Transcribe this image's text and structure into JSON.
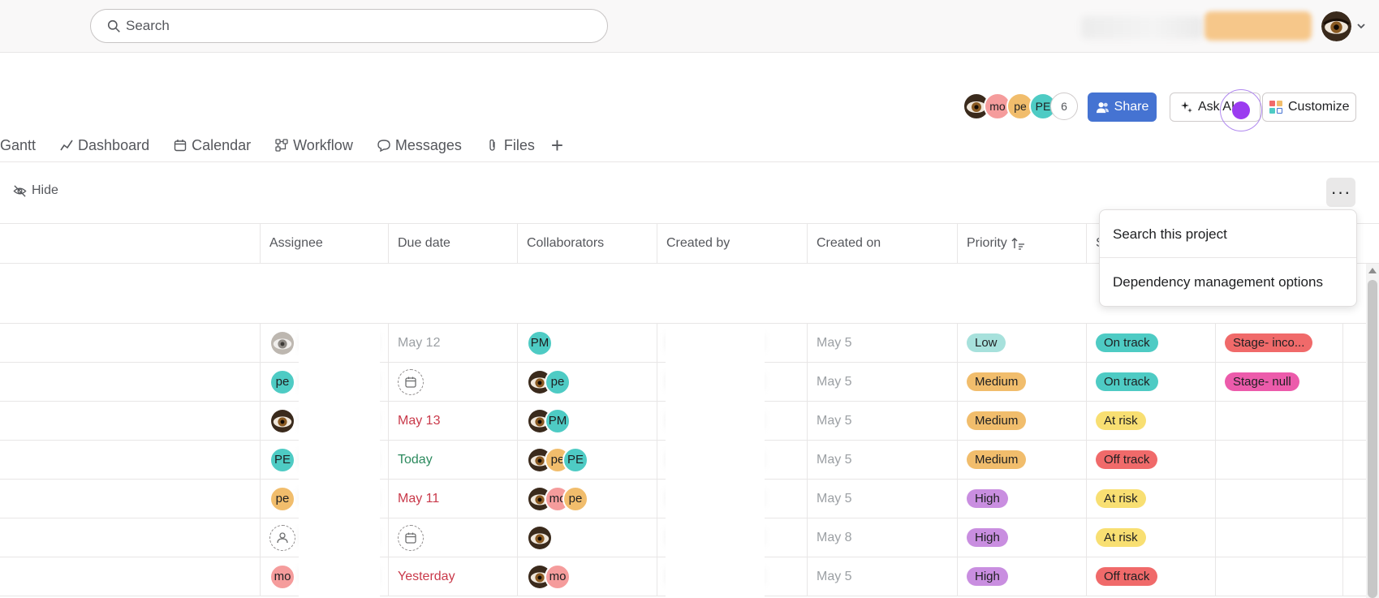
{
  "topbar": {
    "search_placeholder": "Search"
  },
  "header": {
    "members": [
      {
        "initials": "",
        "color": "#5b3b1e",
        "photo": true
      },
      {
        "initials": "mo",
        "color": "#f59c9c"
      },
      {
        "initials": "pe",
        "color": "#f1bd6c"
      },
      {
        "initials": "PE",
        "color": "#4ecbc4"
      }
    ],
    "member_count": "6",
    "share_label": "Share",
    "ask_ai_label": "Ask AI",
    "customize_label": "Customize"
  },
  "tabs": [
    {
      "label": "Gantt",
      "icon": "gantt-icon"
    },
    {
      "label": "Dashboard",
      "icon": "dashboard-icon"
    },
    {
      "label": "Calendar",
      "icon": "calendar-icon"
    },
    {
      "label": "Workflow",
      "icon": "workflow-icon"
    },
    {
      "label": "Messages",
      "icon": "message-icon"
    },
    {
      "label": "Files",
      "icon": "paperclip-icon"
    }
  ],
  "toolbar": {
    "hide_label": "Hide",
    "more_label": "···"
  },
  "columns": {
    "assignee": "Assignee",
    "due_date": "Due date",
    "collaborators": "Collaborators",
    "created_by": "Created by",
    "created_on": "Created on",
    "priority": "Priority",
    "status": "S"
  },
  "menu": {
    "items": [
      "Search this project",
      "Dependency management options"
    ]
  },
  "colors": {
    "low": "#a7e1dc",
    "medium": "#f1bd6c",
    "high": "#c98ee0",
    "on_track": "#4ecbc4",
    "at_risk": "#f8df72",
    "off_track": "#f06a6a",
    "stage_inco": "#f06a6a",
    "stage_null": "#ec5bab",
    "date_red": "#c9394a",
    "date_green": "#2c8a5e",
    "date_grey": "#9ca0a4"
  },
  "rows": [
    {
      "assignee": {
        "initials": "",
        "type": "photo-grey"
      },
      "due": {
        "text": "May 12",
        "tone": "grey"
      },
      "collaborators": [
        {
          "initials": "PM",
          "color": "#4ecbc4"
        }
      ],
      "created_on": "May 5",
      "priority": {
        "text": "Low",
        "tone": "low"
      },
      "status": {
        "text": "On track",
        "tone": "on_track"
      },
      "stage": {
        "text": "Stage- inco...",
        "tone": "stage_inco"
      }
    },
    {
      "assignee": {
        "initials": "pe",
        "color": "#4ecbc4"
      },
      "due": {
        "text": "",
        "tone": "empty"
      },
      "collaborators": [
        {
          "initials": "",
          "photo": true
        },
        {
          "initials": "pe",
          "color": "#4ecbc4"
        }
      ],
      "created_on": "May 5",
      "priority": {
        "text": "Medium",
        "tone": "medium"
      },
      "status": {
        "text": "On track",
        "tone": "on_track"
      },
      "stage": {
        "text": "Stage- null",
        "tone": "stage_null"
      }
    },
    {
      "assignee": {
        "initials": "",
        "type": "photo"
      },
      "due": {
        "text": "May 13",
        "tone": "red"
      },
      "collaborators": [
        {
          "initials": "",
          "photo": true
        },
        {
          "initials": "PM",
          "color": "#4ecbc4"
        }
      ],
      "created_on": "May 5",
      "priority": {
        "text": "Medium",
        "tone": "medium"
      },
      "status": {
        "text": "At risk",
        "tone": "at_risk"
      },
      "stage": {
        "text": "",
        "tone": ""
      }
    },
    {
      "assignee": {
        "initials": "PE",
        "color": "#4ecbc4"
      },
      "due": {
        "text": "Today",
        "tone": "green"
      },
      "collaborators": [
        {
          "initials": "",
          "photo": true
        },
        {
          "initials": "pe",
          "color": "#f1bd6c"
        },
        {
          "initials": "PE",
          "color": "#4ecbc4"
        }
      ],
      "created_on": "May 5",
      "priority": {
        "text": "Medium",
        "tone": "medium"
      },
      "status": {
        "text": "Off track",
        "tone": "off_track"
      },
      "stage": {
        "text": "",
        "tone": ""
      }
    },
    {
      "assignee": {
        "initials": "pe",
        "color": "#f1bd6c"
      },
      "due": {
        "text": "May 11",
        "tone": "red"
      },
      "collaborators": [
        {
          "initials": "",
          "photo": true
        },
        {
          "initials": "mo",
          "color": "#f59c9c"
        },
        {
          "initials": "pe",
          "color": "#f1bd6c"
        }
      ],
      "created_on": "May 5",
      "priority": {
        "text": "High",
        "tone": "high"
      },
      "status": {
        "text": "At risk",
        "tone": "at_risk"
      },
      "stage": {
        "text": "",
        "tone": ""
      }
    },
    {
      "assignee": {
        "initials": "",
        "type": "empty"
      },
      "due": {
        "text": "",
        "tone": "empty"
      },
      "collaborators": [
        {
          "initials": "",
          "photo": true
        }
      ],
      "created_on": "May 8",
      "priority": {
        "text": "High",
        "tone": "high"
      },
      "status": {
        "text": "At risk",
        "tone": "at_risk"
      },
      "stage": {
        "text": "",
        "tone": ""
      }
    },
    {
      "assignee": {
        "initials": "mo",
        "color": "#f59c9c"
      },
      "due": {
        "text": "Yesterday",
        "tone": "red"
      },
      "collaborators": [
        {
          "initials": "",
          "photo": true
        },
        {
          "initials": "mo",
          "color": "#f59c9c"
        }
      ],
      "created_on": "May 5",
      "priority": {
        "text": "High",
        "tone": "high"
      },
      "status": {
        "text": "Off track",
        "tone": "off_track"
      },
      "stage": {
        "text": "",
        "tone": ""
      }
    }
  ]
}
